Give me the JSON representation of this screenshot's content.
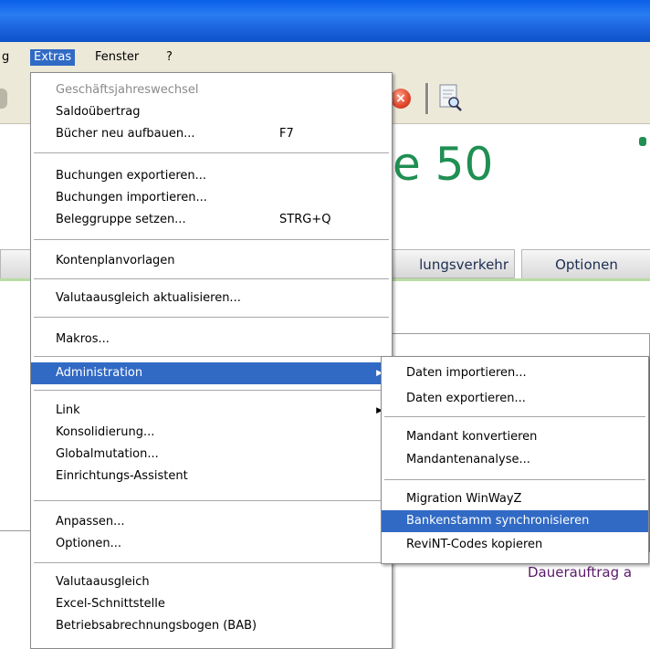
{
  "menubar": {
    "partial_left": "g",
    "extras": "Extras",
    "fenster": "Fenster",
    "help": "?"
  },
  "brand": {
    "text": "e 50"
  },
  "tabs": {
    "partial": "lungsverkehr",
    "options": "Optionen"
  },
  "content": {
    "dauerauftrag": "Dauerauftrag a"
  },
  "extras_menu": {
    "items": [
      {
        "label": "Geschäftsjahreswechsel",
        "shortcut": ""
      },
      {
        "label": "Saldoübertrag",
        "shortcut": ""
      },
      {
        "label": "Bücher neu aufbauen...",
        "shortcut": "F7"
      },
      {
        "label": "Buchungen exportieren...",
        "shortcut": ""
      },
      {
        "label": "Buchungen importieren...",
        "shortcut": ""
      },
      {
        "label": "Beleggruppe setzen...",
        "shortcut": "STRG+Q"
      },
      {
        "label": "Kontenplanvorlagen",
        "shortcut": ""
      },
      {
        "label": "Valutaausgleich aktualisieren...",
        "shortcut": ""
      },
      {
        "label": "Makros...",
        "shortcut": ""
      },
      {
        "label": "Administration",
        "shortcut": ""
      },
      {
        "label": "Link",
        "shortcut": ""
      },
      {
        "label": "Konsolidierung...",
        "shortcut": ""
      },
      {
        "label": "Globalmutation...",
        "shortcut": ""
      },
      {
        "label": "Einrichtungs-Assistent",
        "shortcut": ""
      },
      {
        "label": "Anpassen...",
        "shortcut": ""
      },
      {
        "label": "Optionen...",
        "shortcut": ""
      },
      {
        "label": "Valutaausgleich",
        "shortcut": ""
      },
      {
        "label": "Excel-Schnittstelle",
        "shortcut": ""
      },
      {
        "label": "Betriebsabrechnungsbogen (BAB)",
        "shortcut": ""
      }
    ]
  },
  "admin_menu": {
    "items": [
      {
        "label": "Daten importieren..."
      },
      {
        "label": "Daten exportieren..."
      },
      {
        "label": "Mandant konvertieren"
      },
      {
        "label": "Mandantenanalyse..."
      },
      {
        "label": "Migration WinWayZ"
      },
      {
        "label": "Bankenstamm synchronisieren"
      },
      {
        "label": "ReviNT-Codes kopieren"
      }
    ]
  },
  "colors": {
    "titlebar": "#0a5fe8",
    "menu_highlight": "#316ac5",
    "brand_green": "#1f8f52"
  }
}
